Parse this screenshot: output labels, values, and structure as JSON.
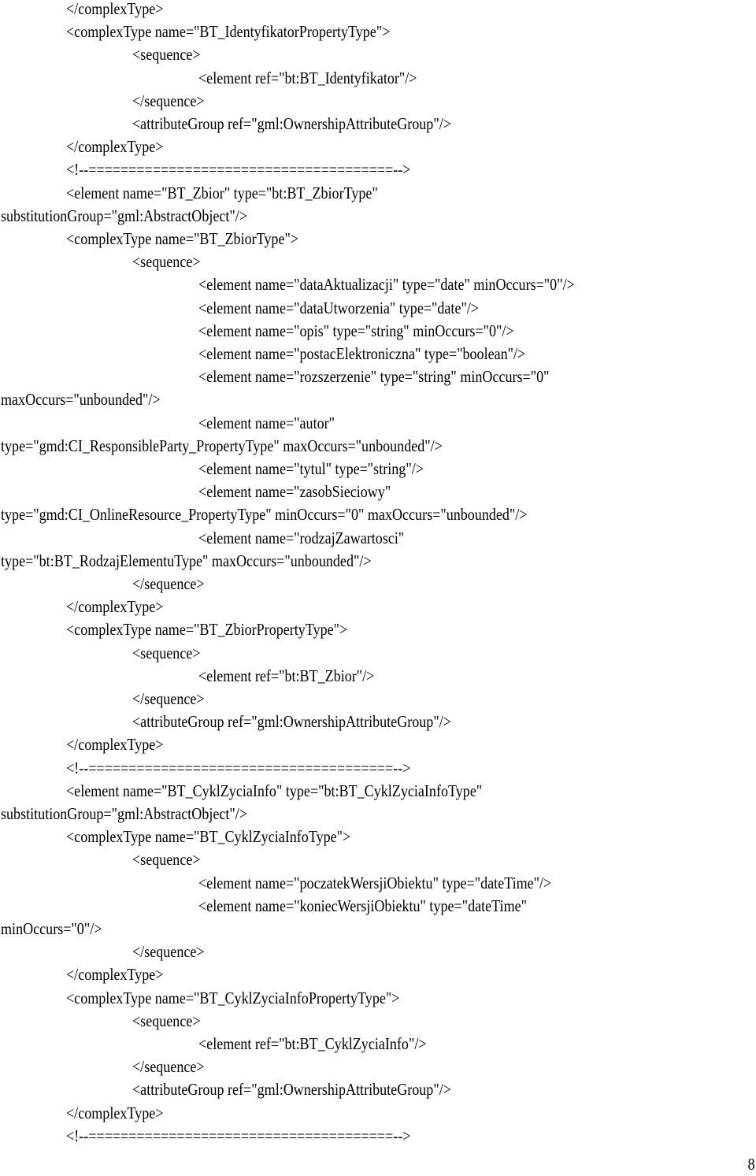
{
  "document": {
    "lines": [
      {
        "indent": 1,
        "text": "</complexType>"
      },
      {
        "indent": 1,
        "text": "<complexType name=\"BT_IdentyfikatorPropertyType\">"
      },
      {
        "indent": 2,
        "text": "<sequence>"
      },
      {
        "indent": 3,
        "text": "<element ref=\"bt:BT_Identyfikator\"/>"
      },
      {
        "indent": 2,
        "text": "</sequence>"
      },
      {
        "indent": 2,
        "text": "<attributeGroup ref=\"gml:OwnershipAttributeGroup\"/>"
      },
      {
        "indent": 1,
        "text": "</complexType>"
      },
      {
        "indent": 1,
        "text": "<!--======================================-->"
      },
      {
        "indent": 1,
        "text": "<element name=\"BT_Zbior\" type=\"bt:BT_ZbiorType\""
      },
      {
        "indent": 0,
        "text": "substitutionGroup=\"gml:AbstractObject\"/>"
      },
      {
        "indent": 1,
        "text": "<complexType name=\"BT_ZbiorType\">"
      },
      {
        "indent": 2,
        "text": "<sequence>"
      },
      {
        "indent": 3,
        "text": "<element name=\"dataAktualizacji\" type=\"date\" minOccurs=\"0\"/>"
      },
      {
        "indent": 3,
        "text": "<element name=\"dataUtworzenia\" type=\"date\"/>"
      },
      {
        "indent": 3,
        "text": "<element name=\"opis\" type=\"string\" minOccurs=\"0\"/>"
      },
      {
        "indent": 3,
        "text": "<element name=\"postacElektroniczna\" type=\"boolean\"/>"
      },
      {
        "indent": 3,
        "text": "<element name=\"rozszerzenie\" type=\"string\" minOccurs=\"0\""
      },
      {
        "indent": 0,
        "text": "maxOccurs=\"unbounded\"/>"
      },
      {
        "indent": 3,
        "text": "<element name=\"autor\""
      },
      {
        "indent": 0,
        "text": "type=\"gmd:CI_ResponsibleParty_PropertyType\" maxOccurs=\"unbounded\"/>"
      },
      {
        "indent": 3,
        "text": "<element name=\"tytul\" type=\"string\"/>"
      },
      {
        "indent": 3,
        "text": "<element name=\"zasobSieciowy\""
      },
      {
        "indent": 0,
        "text": "type=\"gmd:CI_OnlineResource_PropertyType\" minOccurs=\"0\" maxOccurs=\"unbounded\"/>"
      },
      {
        "indent": 3,
        "text": "<element name=\"rodzajZawartosci\""
      },
      {
        "indent": 0,
        "text": "type=\"bt:BT_RodzajElementuType\" maxOccurs=\"unbounded\"/>"
      },
      {
        "indent": 2,
        "text": "</sequence>"
      },
      {
        "indent": 1,
        "text": "</complexType>"
      },
      {
        "indent": 1,
        "text": "<complexType name=\"BT_ZbiorPropertyType\">"
      },
      {
        "indent": 2,
        "text": "<sequence>"
      },
      {
        "indent": 3,
        "text": "<element ref=\"bt:BT_Zbior\"/>"
      },
      {
        "indent": 2,
        "text": "</sequence>"
      },
      {
        "indent": 2,
        "text": "<attributeGroup ref=\"gml:OwnershipAttributeGroup\"/>"
      },
      {
        "indent": 1,
        "text": "</complexType>"
      },
      {
        "indent": 1,
        "text": "<!--======================================-->"
      },
      {
        "indent": 1,
        "text": "<element name=\"BT_CyklZyciaInfo\" type=\"bt:BT_CyklZyciaInfoType\""
      },
      {
        "indent": 0,
        "text": "substitutionGroup=\"gml:AbstractObject\"/>"
      },
      {
        "indent": 1,
        "text": "<complexType name=\"BT_CyklZyciaInfoType\">"
      },
      {
        "indent": 2,
        "text": "<sequence>"
      },
      {
        "indent": 3,
        "text": "<element name=\"poczatekWersjiObiektu\" type=\"dateTime\"/>"
      },
      {
        "indent": 3,
        "text": "<element name=\"koniecWersjiObiektu\" type=\"dateTime\""
      },
      {
        "indent": 0,
        "text": "minOccurs=\"0\"/>"
      },
      {
        "indent": 2,
        "text": "</sequence>"
      },
      {
        "indent": 1,
        "text": "</complexType>"
      },
      {
        "indent": 1,
        "text": "<complexType name=\"BT_CyklZyciaInfoPropertyType\">"
      },
      {
        "indent": 2,
        "text": "<sequence>"
      },
      {
        "indent": 3,
        "text": "<element ref=\"bt:BT_CyklZyciaInfo\"/>"
      },
      {
        "indent": 2,
        "text": "</sequence>"
      },
      {
        "indent": 2,
        "text": "<attributeGroup ref=\"gml:OwnershipAttributeGroup\"/>"
      },
      {
        "indent": 1,
        "text": "</complexType>"
      },
      {
        "indent": 1,
        "text": "<!--======================================-->"
      }
    ],
    "page_number": "8"
  }
}
